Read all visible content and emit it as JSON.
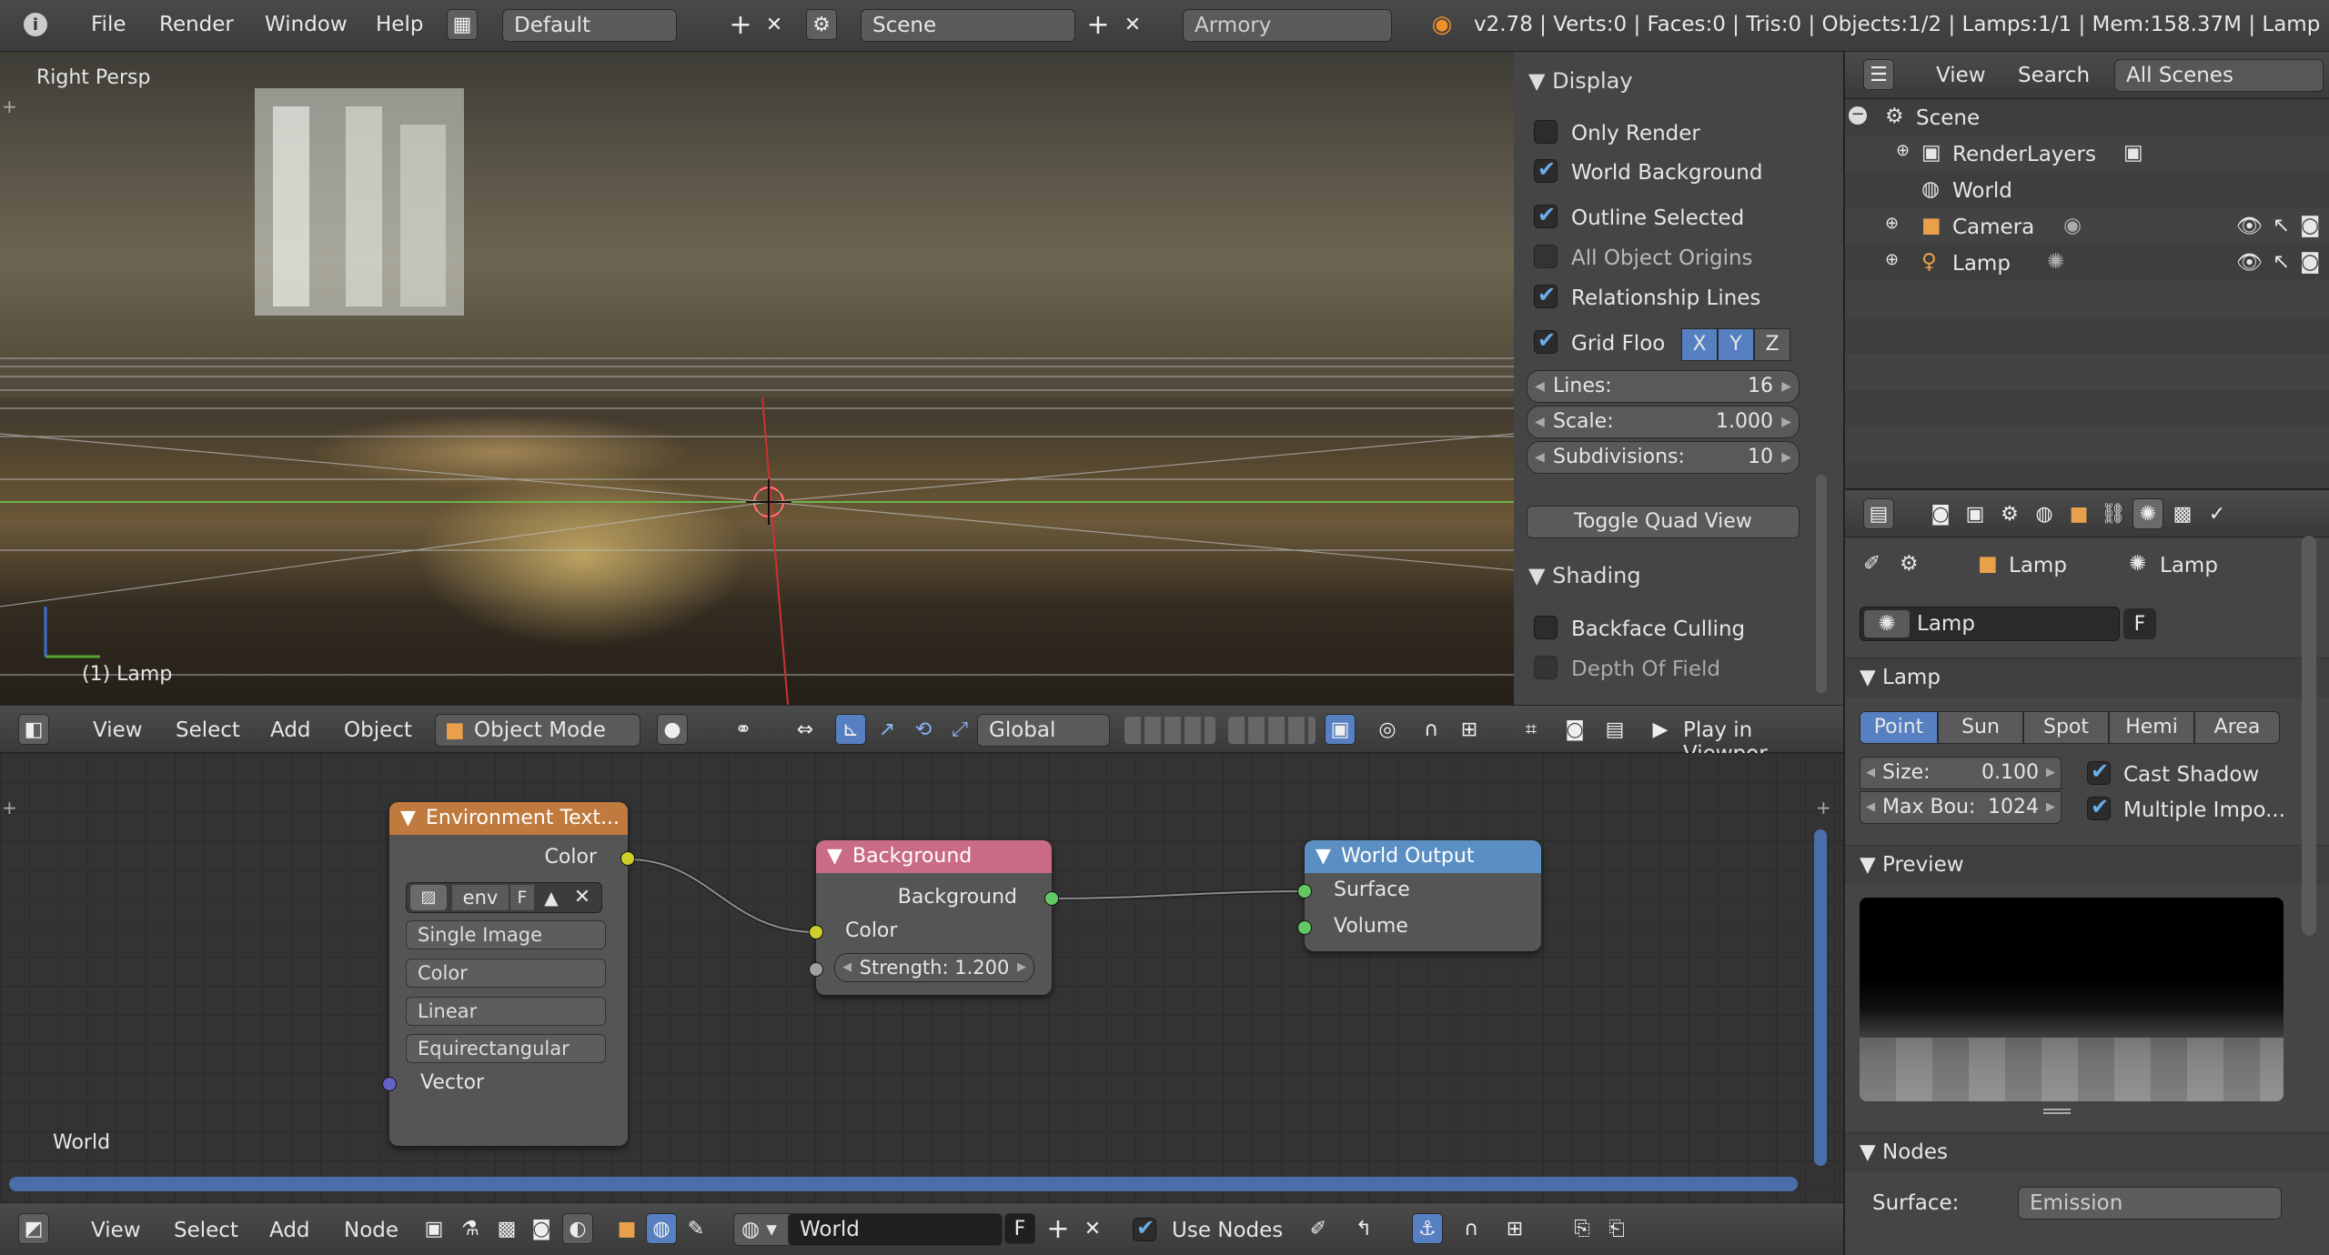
{
  "topbar": {
    "menus": [
      "File",
      "Render",
      "Window",
      "Help"
    ],
    "layout": "Default",
    "scene": "Scene",
    "engine": "Armory",
    "stats": "v2.78 | Verts:0 | Faces:0 | Tris:0 | Objects:1/2 | Lamps:1/1 | Mem:158.37M | Lamp"
  },
  "viewport": {
    "view_name": "Right Persp",
    "object_label": "(1) Lamp"
  },
  "display_panel": {
    "title": "Display",
    "items": [
      {
        "label": "Only Render",
        "checked": false
      },
      {
        "label": "World Background",
        "checked": true
      },
      {
        "label": "Outline Selected",
        "checked": true
      },
      {
        "label": "All Object Origins",
        "checked": false
      },
      {
        "label": "Relationship Lines",
        "checked": true
      }
    ],
    "grid_floor": "Grid Floo",
    "axes": [
      "X",
      "Y",
      "Z"
    ],
    "lines_label": "Lines:",
    "lines_value": "16",
    "scale_label": "Scale:",
    "scale_value": "1.000",
    "subdiv_label": "Subdivisions:",
    "subdiv_value": "10",
    "toggle_quad": "Toggle Quad View"
  },
  "shading_panel": {
    "title": "Shading",
    "backface": "Backface Culling",
    "dof": "Depth Of Field"
  },
  "header3d": {
    "menus": [
      "View",
      "Select",
      "Add",
      "Object"
    ],
    "mode": "Object Mode",
    "orientation": "Global",
    "play": "Play in Viewpor"
  },
  "nodes": {
    "env": {
      "title": "Environment Text...",
      "out_color": "Color",
      "image": "env",
      "fake": "F",
      "source": "Single Image",
      "colorspace": "Color",
      "interp": "Linear",
      "projection": "Equirectangular",
      "vector": "Vector"
    },
    "bg": {
      "title": "Background",
      "out": "Background",
      "color": "Color",
      "strength": "Strength: 1.200"
    },
    "out": {
      "title": "World Output",
      "surface": "Surface",
      "volume": "Volume"
    },
    "editor_label": "World"
  },
  "bottombar": {
    "menus": [
      "View",
      "Select",
      "Add",
      "Node"
    ],
    "world": "World",
    "fake": "F",
    "use_nodes": "Use Nodes"
  },
  "outliner": {
    "menus": [
      "View",
      "Search"
    ],
    "filter": "All Scenes",
    "items": [
      "Scene",
      "RenderLayers",
      "World",
      "Camera",
      "Lamp"
    ]
  },
  "properties": {
    "crumbs": [
      "Lamp",
      "Lamp"
    ],
    "data_name": "Lamp",
    "fake": "F",
    "lamp_panel": "Lamp",
    "types": [
      "Point",
      "Sun",
      "Spot",
      "Hemi",
      "Area"
    ],
    "size_label": "Size:",
    "size_value": "0.100",
    "maxb_label": "Max Bou:",
    "maxb_value": "1024",
    "cast_shadow": "Cast Shadow",
    "multi_imp": "Multiple Impo...",
    "preview": "Preview",
    "nodes": "Nodes",
    "surface_label": "Surface:",
    "surface_value": "Emission"
  },
  "colors": {
    "accent": "#5680c2",
    "env_header": "#c07a3e",
    "bg_header": "#c96b84",
    "out_header": "#5b8fc4",
    "socket_yellow": "#cfcf29",
    "socket_green": "#63c763",
    "socket_gray": "#a1a1a1",
    "socket_purple": "#6363c7"
  }
}
